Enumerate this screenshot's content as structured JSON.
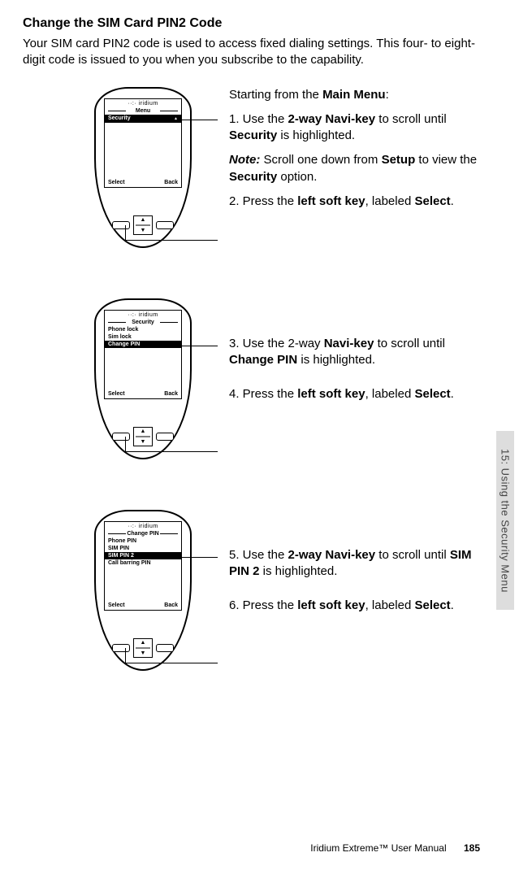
{
  "heading": "Change the SIM Card PIN2 Code",
  "intro": "Your SIM card PIN2 code is used to access fixed dialing settings. This four- to eight-digit code is issued to you when you subscribe to the capability.",
  "start_line_prefix": "Starting from the ",
  "start_line_bold": "Main Menu",
  "start_line_suffix": ":",
  "steps": {
    "s1a": "1. Use the ",
    "s1b": "2-way Navi-key",
    "s1c": " to scroll until ",
    "s1d": "Security",
    "s1e": " is highlighted.",
    "note_label": "Note:",
    "note_a": " Scroll one down from ",
    "note_b": "Setup",
    "note_c": " to view the ",
    "note_d": "Security",
    "note_e": " option.",
    "s2a": "2. Press the ",
    "s2b": "left soft key",
    "s2c": ", labeled ",
    "s2d": "Select",
    "s2e": ".",
    "s3a": "3. Use the 2-way ",
    "s3b": "Navi-key",
    "s3c": " to scroll until ",
    "s3d": "Change PIN",
    "s3e": " is highlighted.",
    "s4a": "4. Press the ",
    "s4b": "left soft key",
    "s4c": ", labeled ",
    "s4d": "Select",
    "s4e": ".",
    "s5a": "5. Use the ",
    "s5b": "2-way Navi-key",
    "s5c": " to scroll until ",
    "s5d": "SIM PIN 2",
    "s5e": " is highlighted.",
    "s6a": "6. Press the ",
    "s6b": "left soft key",
    "s6c": ", labeled ",
    "s6d": "Select",
    "s6e": "."
  },
  "phone_common": {
    "brand": "iridium",
    "select": "Select",
    "back": "Back"
  },
  "phone1": {
    "title": "Menu",
    "highlight": "Security"
  },
  "phone2": {
    "title": "Security",
    "items": [
      "Phone lock",
      "Sim lock"
    ],
    "highlight": "Change PIN"
  },
  "phone3": {
    "title": "Change PIN",
    "items_top": [
      "Phone PIN",
      "SIM PIN"
    ],
    "highlight": "SIM PIN 2",
    "items_bottom": [
      "Call barring PIN"
    ]
  },
  "side_tab": "15: Using the Security Menu",
  "footer_text": "Iridium Extreme™ User Manual",
  "page_number": "185"
}
